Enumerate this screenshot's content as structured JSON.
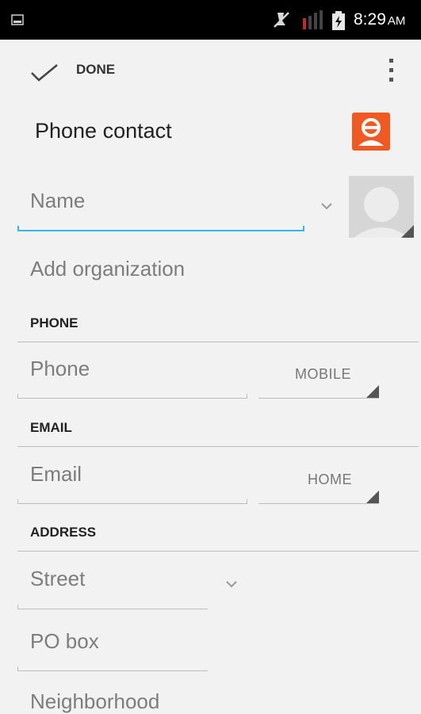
{
  "status_bar": {
    "time": "8:29",
    "ampm": "AM"
  },
  "action_bar": {
    "done_label": "DONE"
  },
  "account": {
    "title": "Phone contact"
  },
  "name": {
    "placeholder": "Name"
  },
  "organization": {
    "label": "Add organization"
  },
  "phone": {
    "header": "PHONE",
    "placeholder": "Phone",
    "type": "MOBILE"
  },
  "email": {
    "header": "EMAIL",
    "placeholder": "Email",
    "type": "HOME"
  },
  "address": {
    "header": "ADDRESS",
    "street": "Street",
    "po_box": "PO box",
    "neighborhood": "Neighborhood"
  },
  "colors": {
    "accent": "#33b5e5",
    "account_icon": "#f05a22"
  }
}
